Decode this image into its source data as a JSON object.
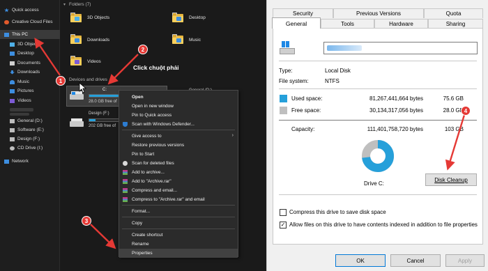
{
  "sidebar": {
    "items": [
      {
        "label": "Quick access",
        "icon": "star-icon",
        "color": "#3d8ee0"
      },
      {
        "label": "Creative Cloud Files",
        "icon": "cloud-icon",
        "color": "#e35a2c"
      },
      {
        "label": "This PC",
        "icon": "computer-icon",
        "color": "#3d8ee0"
      },
      {
        "label": "3D Objects",
        "icon": "cube-icon",
        "color": "#4fb0e8"
      },
      {
        "label": "Desktop",
        "icon": "desktop-icon",
        "color": "#3d8ee0"
      },
      {
        "label": "Documents",
        "icon": "document-icon",
        "color": "#cfcfcf"
      },
      {
        "label": "Downloads",
        "icon": "download-icon",
        "color": "#3d8ee0"
      },
      {
        "label": "Music",
        "icon": "music-icon",
        "color": "#3d8ee0"
      },
      {
        "label": "Pictures",
        "icon": "pictures-icon",
        "color": "#3d8ee0"
      },
      {
        "label": "Videos",
        "icon": "video-icon",
        "color": "#7d5bd6"
      },
      {
        "label": "General (D:)",
        "icon": "drive-icon",
        "color": "#bdbdbd"
      },
      {
        "label": "Software (E:)",
        "icon": "drive-icon",
        "color": "#bdbdbd"
      },
      {
        "label": "Design (F:)",
        "icon": "drive-icon",
        "color": "#bdbdbd"
      },
      {
        "label": "CD Drive (I:)",
        "icon": "cd-icon",
        "color": "#bdbdbd"
      },
      {
        "label": "Network",
        "icon": "network-icon",
        "color": "#3d8ee0"
      }
    ]
  },
  "main": {
    "folders_header": "Folders (7)",
    "folders": [
      {
        "name": "3D Objects",
        "badge": "#4fb0e8"
      },
      {
        "name": "Desktop",
        "badge": "#3d8ee0"
      },
      {
        "name": "Downloads",
        "badge": "#3d8ee0"
      },
      {
        "name": "Music",
        "badge": "#3d8ee0"
      },
      {
        "name": "Videos",
        "badge": "#7d5bd6"
      }
    ],
    "devices_header": "Devices and drives",
    "drive_c": {
      "name": "C:",
      "free": "28.0 GB free of",
      "used_fraction": 0.73
    },
    "drive_d": {
      "name": "General (D:)"
    },
    "drive_f": {
      "name": "Design (F:)",
      "free": "202 GB free of",
      "used_fraction": 0.2
    }
  },
  "context_menu": {
    "items": [
      "Open",
      "Open in new window",
      "Pin to Quick access",
      "Scan with Windows Defender...",
      "Give access to",
      "Restore previous versions",
      "Pin to Start",
      "Scan for deleted files",
      "Add to archive...",
      "Add to \"Archive.rar\"",
      "Compress and email...",
      "Compress to \"Archive.rar\" and email",
      "Format...",
      "Copy",
      "Create shortcut",
      "Rename",
      "Properties"
    ]
  },
  "annotations": {
    "step1": "1",
    "step2": "2",
    "step3": "3",
    "step4": "4",
    "right_click_text": "Click chuột phải",
    "color": "#e53935"
  },
  "dialog": {
    "tabs_row1": [
      "Security",
      "Previous Versions",
      "Quota"
    ],
    "tabs_row2": [
      "General",
      "Tools",
      "Hardware",
      "Sharing"
    ],
    "type_label": "Type:",
    "type_value": "Local Disk",
    "fs_label": "File system:",
    "fs_value": "NTFS",
    "used_label": "Used space:",
    "used_bytes": "81,267,441,664 bytes",
    "used_gb": "75.6 GB",
    "used_color": "#26a0da",
    "free_label": "Free space:",
    "free_bytes": "30,134,317,056 bytes",
    "free_gb": "28.0 GB",
    "free_color": "#bfbfbf",
    "capacity_label": "Capacity:",
    "capacity_bytes": "111,401,758,720 bytes",
    "capacity_gb": "103 GB",
    "drive_label": "Drive C:",
    "disk_cleanup": "Disk Cleanup",
    "compress_label": "Compress this drive to save disk space",
    "compress_checked": false,
    "index_label": "Allow files on this drive to have contents indexed in addition to file properties",
    "index_checked": true,
    "index_check_glyph": "✓",
    "ok": "OK",
    "cancel": "Cancel",
    "apply": "Apply",
    "used_fraction": 0.73
  }
}
